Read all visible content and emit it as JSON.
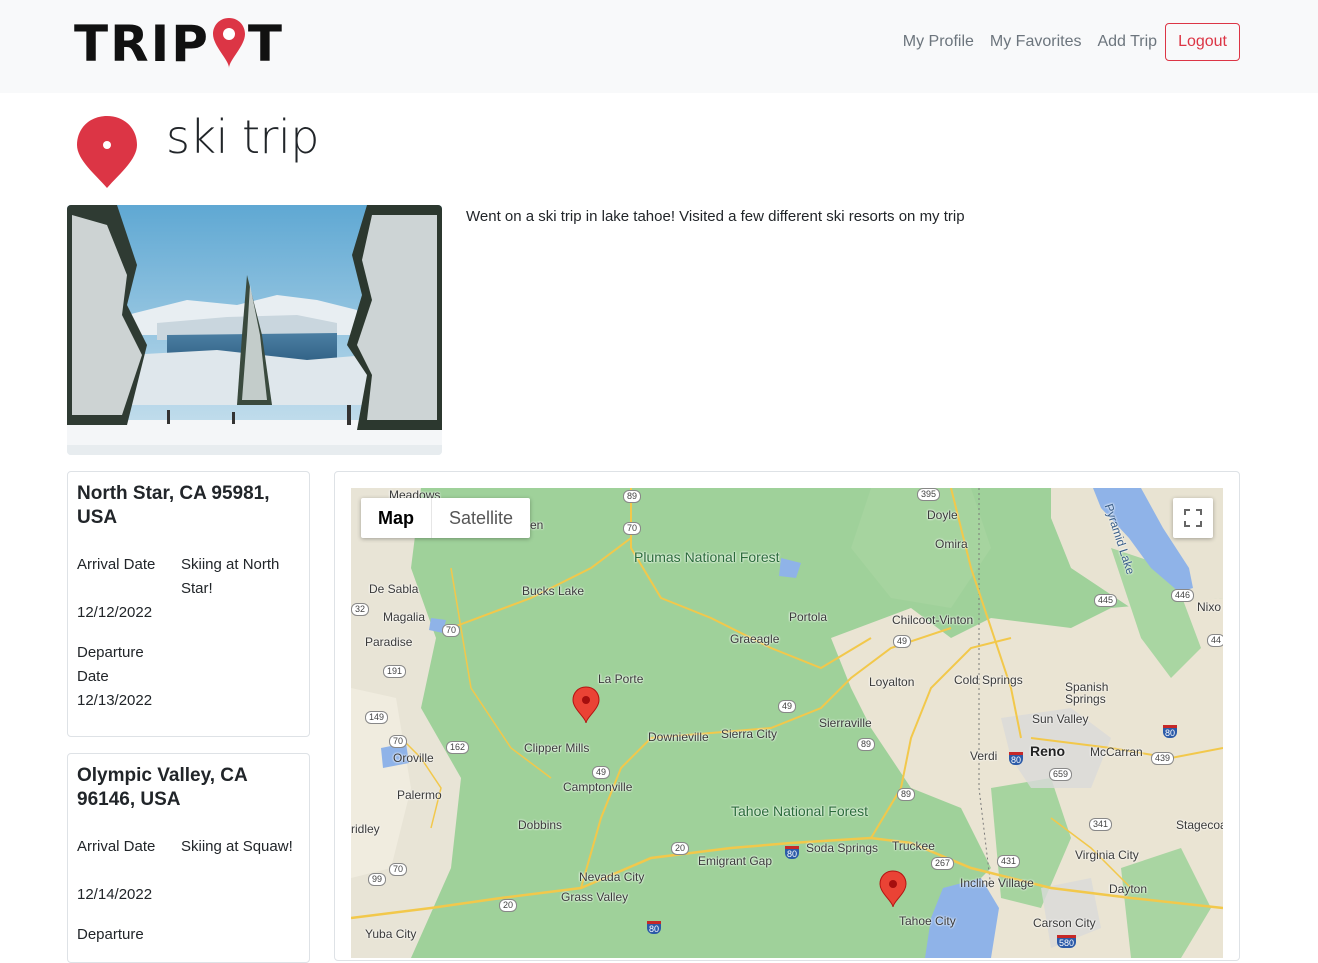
{
  "brand": {
    "logo_text_left": "TRIP",
    "logo_text_right": "T",
    "accent_color": "#dc3545"
  },
  "nav": {
    "profile": "My Profile",
    "favorites": "My Favorites",
    "add_trip": "Add Trip",
    "logout": "Logout"
  },
  "trip": {
    "title": "ski trip",
    "description": "Went on a ski trip in lake tahoe! Visited a few different ski resorts on my trip"
  },
  "stops": [
    {
      "location": "North Star, CA 95981, USA",
      "arrival_label": "Arrival Date",
      "arrival_date": "12/12/2022",
      "departure_label": "Departure Date",
      "departure_date": "12/13/2022",
      "note": "Skiing at North Star!"
    },
    {
      "location": "Olympic Valley, CA 96146, USA",
      "arrival_label": "Arrival Date",
      "arrival_date": "12/14/2022",
      "departure_label": "Departure",
      "note": "Skiing at Squaw!"
    }
  ],
  "map": {
    "type_options": [
      "Map",
      "Satellite"
    ],
    "selected_type": "Map",
    "places": [
      "Meadows",
      "Doyle",
      "Omira",
      "Plumas National Forest",
      "De Sabla",
      "Bucks Lake",
      "Magalia",
      "Paradise",
      "Portola",
      "Chilcoot-Vinton",
      "Graeagle",
      "Nixo",
      "La Porte",
      "Loyalton",
      "Cold Springs",
      "Spanish Springs",
      "Sun Valley",
      "Oroville",
      "Clipper Mills",
      "Downieville",
      "Sierra City",
      "Sierraville",
      "Verdi",
      "Reno",
      "McCarran",
      "Palermo",
      "Camptonville",
      "Tahoe National Forest",
      "Dobbins",
      "ridley",
      "Truckee",
      "Soda Springs",
      "Emigrant Gap",
      "Nevada City",
      "Grass Valley",
      "Incline Village",
      "Virginia City",
      "Stagecoa",
      "Dayton",
      "Tahoe City",
      "Carson City",
      "Yuba City",
      "Pyramid Lake",
      "en"
    ],
    "route_shields": [
      "89",
      "395",
      "70",
      "32",
      "70",
      "191",
      "149",
      "70",
      "162",
      "49",
      "49",
      "89",
      "89",
      "49",
      "20",
      "20",
      "99",
      "70",
      "20",
      "267",
      "431",
      "341",
      "445",
      "446",
      "44",
      "659",
      "439"
    ],
    "interstate_shields": [
      "80",
      "80",
      "80",
      "80",
      "580"
    ],
    "marker_names": [
      "North Star",
      "Olympic Valley"
    ]
  }
}
